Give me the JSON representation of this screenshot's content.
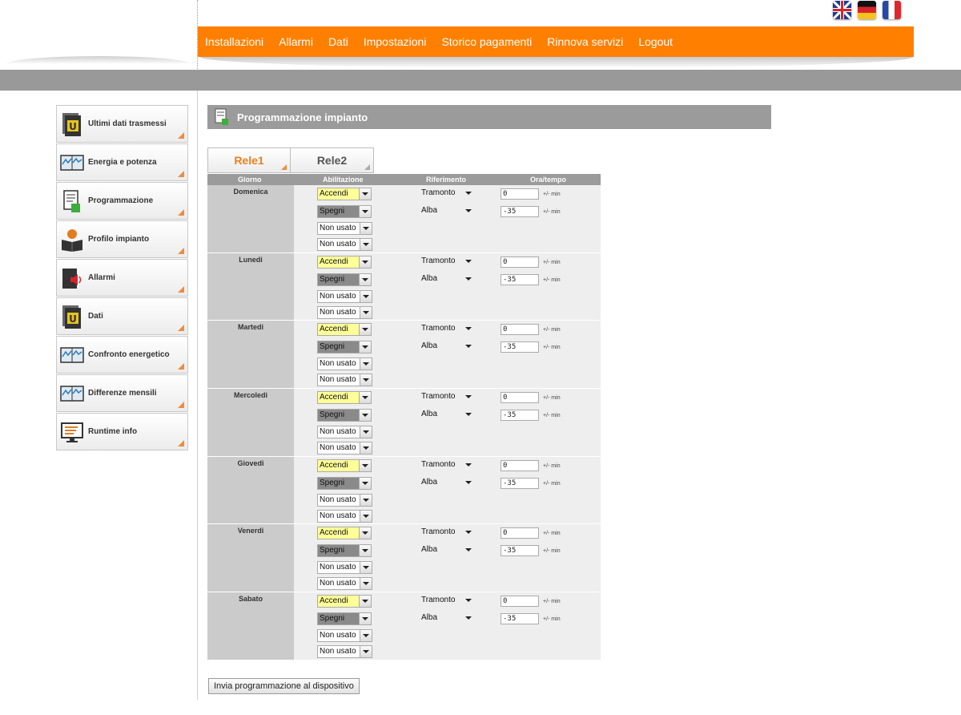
{
  "languages": [
    {
      "name": "English",
      "icon": "uk-flag-icon"
    },
    {
      "name": "Deutsch",
      "icon": "germany-flag-icon"
    },
    {
      "name": "Français",
      "icon": "france-flag-icon"
    }
  ],
  "nav": {
    "items": [
      "Installazioni",
      "Allarmi",
      "Dati",
      "Impostazioni",
      "Storico pagamenti",
      "Rinnova servizi",
      "Logout"
    ],
    "accent_color": "#ff7f00"
  },
  "sidebar": {
    "items": [
      {
        "label": "Ultimi dati trasmessi",
        "icon": "data-book-icon"
      },
      {
        "label": "Energia e potenza",
        "icon": "energy-chart-icon"
      },
      {
        "label": "Programmazione",
        "icon": "programming-icon"
      },
      {
        "label": "Profilo impianto",
        "icon": "plant-profile-icon"
      },
      {
        "label": "Allarmi",
        "icon": "alarm-speaker-icon"
      },
      {
        "label": "Dati",
        "icon": "data-book-icon"
      },
      {
        "label": "Confronto energetico",
        "icon": "energy-chart-icon"
      },
      {
        "label": "Differenze mensili",
        "icon": "energy-chart-icon"
      },
      {
        "label": "Runtime info",
        "icon": "monitor-icon"
      }
    ]
  },
  "main": {
    "title": "Programmazione impianto",
    "tabs": [
      "Rele1",
      "Rele2"
    ],
    "active_tab": "Rele1",
    "columns": {
      "day": "Giorno",
      "enable": "Abilitazione",
      "reference": "Riferimento",
      "time": "Ora/tempo"
    },
    "unit_label": "+/- min",
    "days": [
      {
        "name": "Domenica",
        "enable": [
          "Accendi",
          "Spegni",
          "Non usato",
          "Non usato"
        ],
        "reference": [
          "Tramonto",
          "Alba"
        ],
        "time": [
          "0",
          "-35"
        ]
      },
      {
        "name": "Lunedi",
        "enable": [
          "Accendi",
          "Spegni",
          "Non usato",
          "Non usato"
        ],
        "reference": [
          "Tramonto",
          "Alba"
        ],
        "time": [
          "0",
          "-35"
        ]
      },
      {
        "name": "Martedi",
        "enable": [
          "Accendi",
          "Spegni",
          "Non usato",
          "Non usato"
        ],
        "reference": [
          "Tramonto",
          "Alba"
        ],
        "time": [
          "0",
          "-35"
        ]
      },
      {
        "name": "Mercoledi",
        "enable": [
          "Accendi",
          "Spegni",
          "Non usato",
          "Non usato"
        ],
        "reference": [
          "Tramonto",
          "Alba"
        ],
        "time": [
          "0",
          "-35"
        ]
      },
      {
        "name": "Giovedi",
        "enable": [
          "Accendi",
          "Spegni",
          "Non usato",
          "Non usato"
        ],
        "reference": [
          "Tramonto",
          "Alba"
        ],
        "time": [
          "0",
          "-35"
        ]
      },
      {
        "name": "Venerdi",
        "enable": [
          "Accendi",
          "Spegni",
          "Non usato",
          "Non usato"
        ],
        "reference": [
          "Tramonto",
          "Alba"
        ],
        "time": [
          "0",
          "-35"
        ]
      },
      {
        "name": "Sabato",
        "enable": [
          "Accendi",
          "Spegni",
          "Non usato",
          "Non usato"
        ],
        "reference": [
          "Tramonto",
          "Alba"
        ],
        "time": [
          "0",
          "-35"
        ]
      }
    ],
    "submit_label": "Invia programmazione al dispositivo"
  }
}
